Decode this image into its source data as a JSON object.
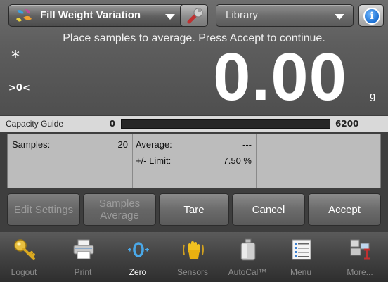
{
  "header": {
    "app_name": "Fill Weight Variation",
    "library_label": "Library",
    "info_glyph": "i",
    "app_icon": "fill-weight-icon",
    "settings_icon": "wrench-icon",
    "info_icon": "info-icon"
  },
  "instruction": "Place samples to average. Press Accept to continue.",
  "display": {
    "stability_indicator": "*",
    "zero_indicator": ">0<",
    "value": "0.00",
    "unit": "g"
  },
  "capacity_guide": {
    "label": "Capacity Guide",
    "min": "0",
    "max": "6200",
    "fill_fraction": 0
  },
  "panel": {
    "samples_label": "Samples:",
    "samples_value": "20",
    "average_label": "Average:",
    "average_value": "---",
    "limit_label": "+/- Limit:",
    "limit_value": "7.50 %"
  },
  "softkeys": {
    "edit_settings": "Edit Settings",
    "samples_average": "Samples Average",
    "tare": "Tare",
    "cancel": "Cancel",
    "accept": "Accept"
  },
  "nav": {
    "logout": "Logout",
    "print": "Print",
    "zero": "Zero",
    "sensors": "Sensors",
    "autocal": "AutoCal™",
    "menu": "Menu",
    "more": "More..."
  },
  "colors": {
    "background": "#4f4f4f",
    "capacity_bar": "#262626",
    "info_blue": "#1c6fd1",
    "zero_icon_blue": "#4aa8e8"
  }
}
